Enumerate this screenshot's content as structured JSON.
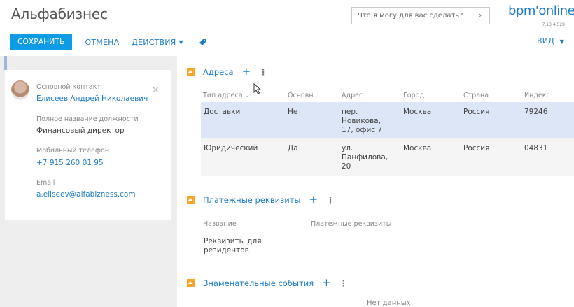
{
  "header": {
    "title": "Альфабизнес",
    "search_placeholder": "Что я могу для вас сделать?",
    "search_go": "›",
    "logo_text": "bpm'online",
    "version": "7.13.4.528"
  },
  "toolbar": {
    "save_label": "СОХРАНИТЬ",
    "cancel_label": "ОТМЕНА",
    "actions_label": "ДЕЙСТВИЯ",
    "view_label": "ВИД"
  },
  "contact": {
    "main_contact_label": "Основной контакт",
    "main_contact_value": "Елисеев Андрей Николаевич",
    "job_label": "Полное название должности",
    "job_value": "Финансовый директор",
    "mobile_label": "Мобильный телефон",
    "mobile_value": "+7 915 260 01 95",
    "email_label": "Email",
    "email_value": "a.eliseev@alfabizness.com"
  },
  "addresses": {
    "title": "Адреса",
    "columns": [
      "Тип адреса",
      "Основн...",
      "Адрес",
      "Город",
      "Страна",
      "Индекс"
    ],
    "rows": [
      {
        "type": "Доставки",
        "primary": "Нет",
        "address": [
          "пер.",
          "Новикова,",
          "17, офис 7"
        ],
        "city": "Москва",
        "country": "Россия",
        "zip": "79246"
      },
      {
        "type": "Юридический",
        "primary": "Да",
        "address": [
          "ул.",
          "Панфилова,",
          "20"
        ],
        "city": "Москва",
        "country": "Россия",
        "zip": "04831"
      }
    ]
  },
  "payments": {
    "title": "Платежные реквизиты",
    "columns": [
      "Название",
      "Платежные реквизиты"
    ],
    "rows": [
      {
        "name": [
          "Реквизиты для",
          "резидентов"
        ]
      }
    ]
  },
  "events": {
    "title": "Знаменательные события",
    "empty_text": "Нет данных"
  },
  "colors": {
    "accent": "#1e7dc8",
    "save_button": "#0e9be6",
    "collapse": "#f7a42a",
    "selected_row": "#dde6f7"
  }
}
